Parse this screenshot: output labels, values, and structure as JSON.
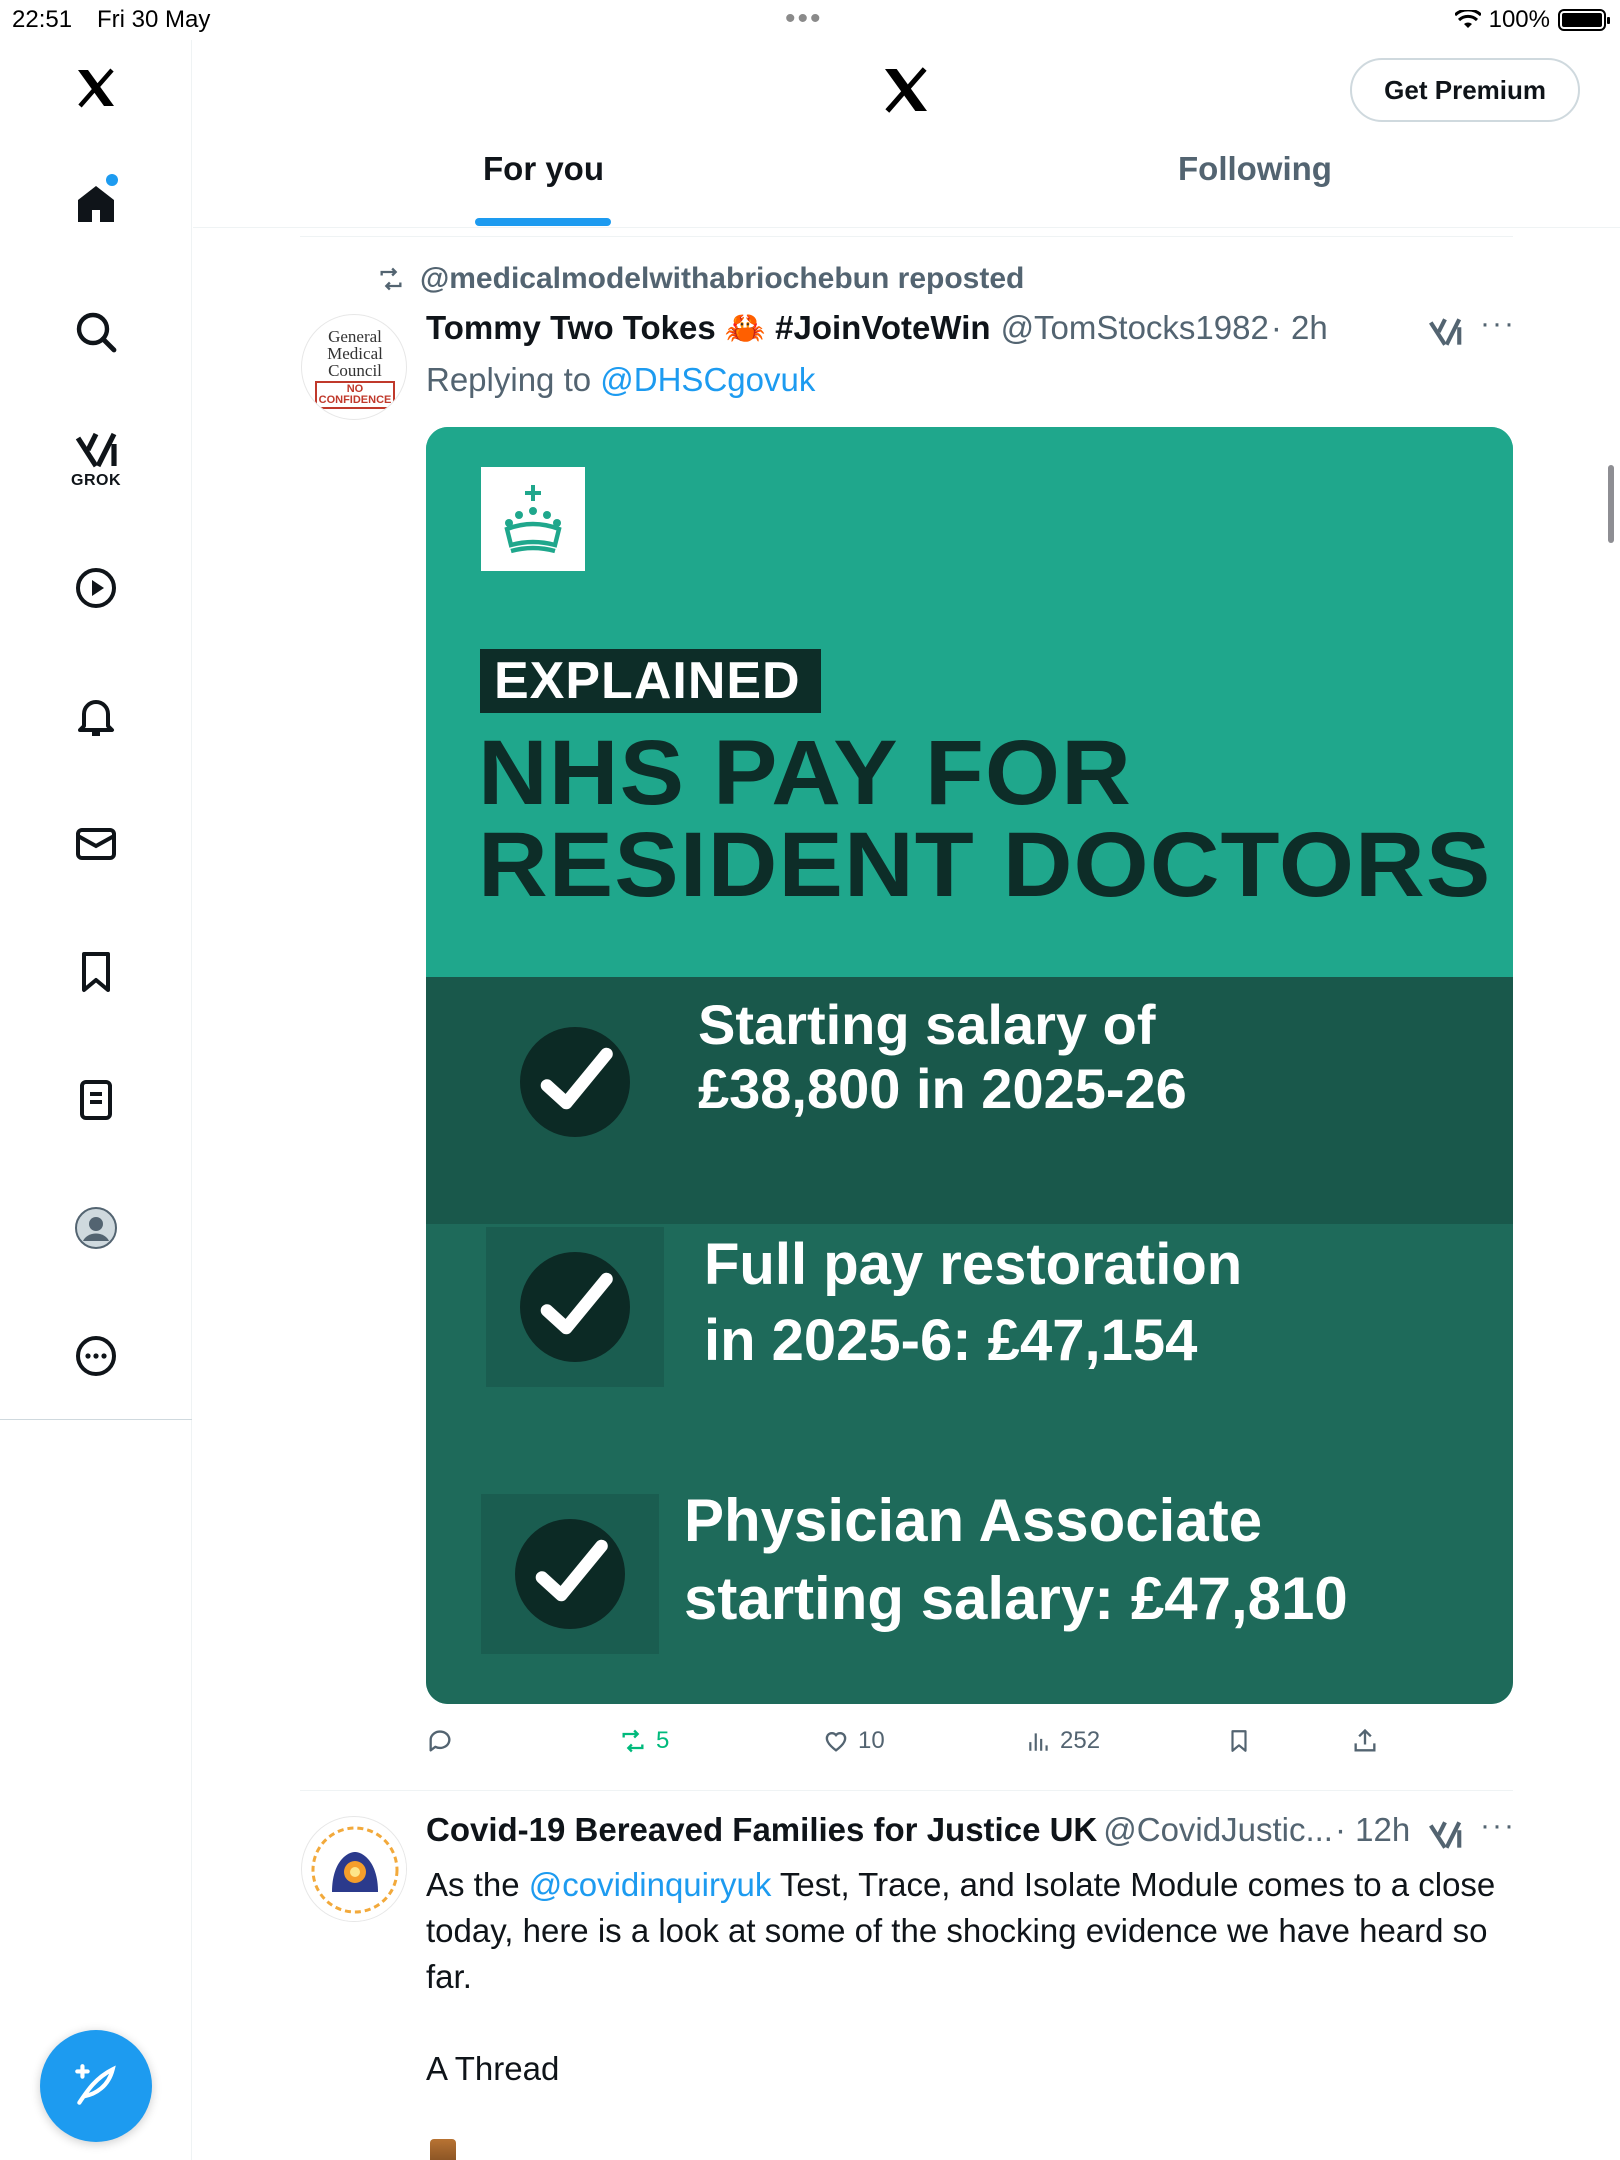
{
  "status_bar": {
    "time": "22:51",
    "date": "Fri 30 May",
    "battery": "100%"
  },
  "header": {
    "premium_label": "Get Premium",
    "tabs": [
      {
        "label": "For you",
        "selected": true
      },
      {
        "label": "Following",
        "selected": false
      }
    ]
  },
  "sidebar": {
    "items": [
      "home",
      "explore",
      "grok",
      "video",
      "notifications",
      "messages",
      "bookmarks",
      "lists",
      "profile",
      "more"
    ],
    "grok_label": "GROK"
  },
  "tweets": [
    {
      "repost_text": "@medicalmodelwithabriochebun reposted",
      "avatar": {
        "line1": "General",
        "line2": "Medical",
        "line3": "Council",
        "stamp_line1": "NO",
        "stamp_line2": "CONFIDENCE"
      },
      "name": "Tommy Two Tokes 🦀 #JoinVoteWin",
      "handle": "@TomStocks1982",
      "time": "· 2h",
      "replying_prefix": "Replying to ",
      "replying_to": "@DHSCgovuk",
      "media": {
        "tag": "EXPLAINED",
        "headline_line1": "NHS PAY FOR",
        "headline_line2": "RESIDENT DOCTORS",
        "points": [
          {
            "line1": "Starting salary of",
            "line2": "£38,800 in 2025-26"
          },
          {
            "line1": "Full pay restoration",
            "line2": "in 2025-6: £47,154"
          },
          {
            "line1": "Physician Associate",
            "line2": "starting salary: £47,810"
          }
        ]
      },
      "stats": {
        "replies": "",
        "reposts": "5",
        "likes": "10",
        "views": "252"
      }
    },
    {
      "name": "Covid-19 Bereaved Families for Justice UK",
      "handle": "@CovidJustic...",
      "time": "· 12h",
      "text_prefix": "As the ",
      "mention": "@covidinquiryuk",
      "text_rest": " Test, Trace, and Isolate Module comes to a close today, here is a look at some of the shocking evidence we have heard so far.",
      "text_thread": "A Thread"
    }
  ],
  "colors": {
    "accent": "#1d9bf0",
    "repost_green": "#00ba7c",
    "card_teal": "#1fa78c",
    "card_dark": "#19584b"
  }
}
